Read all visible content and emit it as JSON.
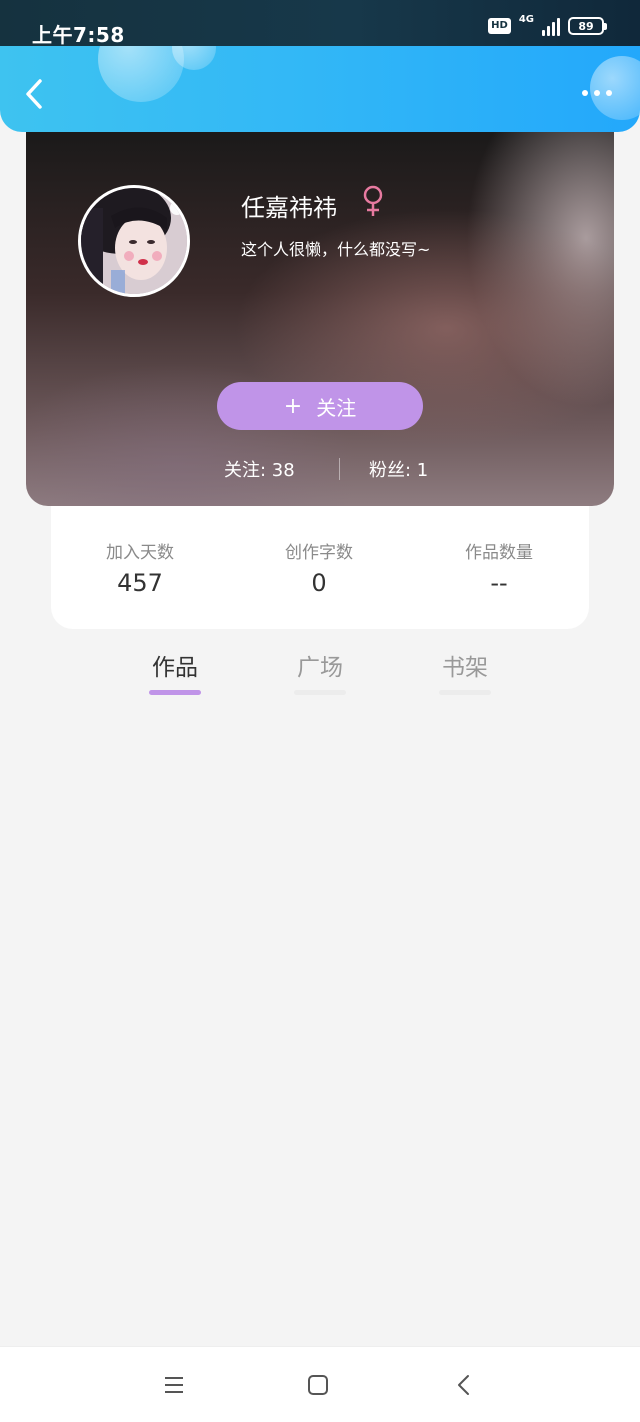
{
  "status_bar": {
    "time": "上午7:58",
    "hd": "HD",
    "network": "4G",
    "battery": "89"
  },
  "header": {
    "back_icon": "chevron-left-icon",
    "more_icon": "more-horizontal-icon"
  },
  "profile": {
    "username": "任嘉祎祎",
    "gender_symbol": "♀",
    "gender_color": "#e77aa0",
    "bio": "这个人很懒，什么都没写~",
    "follow_plus": "+",
    "follow_label": "关注",
    "following": "关注: 38",
    "fans": "粉丝: 1"
  },
  "stats": [
    {
      "label": "加入天数",
      "value": "457"
    },
    {
      "label": "创作字数",
      "value": "0"
    },
    {
      "label": "作品数量",
      "value": "--"
    }
  ],
  "tabs": [
    {
      "label": "作品",
      "active": true
    },
    {
      "label": "广场",
      "active": false
    },
    {
      "label": "书架",
      "active": false
    }
  ],
  "colors": {
    "accent": "#c094e8",
    "header_blue": "#33b8f6"
  },
  "nav": {
    "menu_icon": "menu-icon",
    "home_icon": "square-home-icon",
    "back_icon": "back-chevron-icon"
  }
}
